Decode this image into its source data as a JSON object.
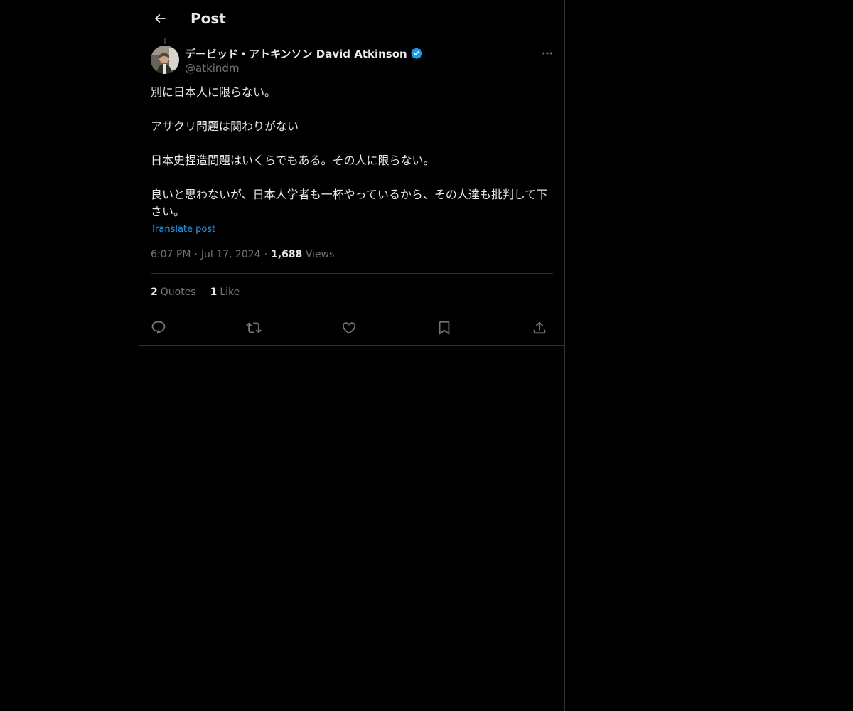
{
  "header": {
    "title": "Post",
    "back_icon": "arrow-left-icon"
  },
  "author": {
    "display_name": "デービッド・アトキンソン David Atkinson",
    "handle": "@atkindm",
    "verified_color": "#1d9bf0"
  },
  "post": {
    "paragraphs": [
      "別に日本人に限らない。",
      "アサクリ問題は関わりがない",
      "日本史捏造問題はいくらでもある。その人に限らない。",
      "良いと思わないが、日本人学者も一杯やっているから、その人達も批判して下さい。"
    ],
    "translate_label": "Translate post",
    "time": "6:07 PM",
    "date": "Jul 17, 2024",
    "separator": "·",
    "views_count": "1,688",
    "views_label": "Views"
  },
  "stats": {
    "quotes_count": "2",
    "quotes_label": "Quotes",
    "likes_count": "1",
    "likes_label": "Like"
  },
  "actions": [
    {
      "name": "reply",
      "icon": "reply-icon"
    },
    {
      "name": "repost",
      "icon": "repost-icon"
    },
    {
      "name": "like",
      "icon": "heart-icon"
    },
    {
      "name": "bookmark",
      "icon": "bookmark-icon"
    },
    {
      "name": "share",
      "icon": "share-icon"
    }
  ],
  "colors": {
    "background": "#000000",
    "text": "#e7e9ea",
    "muted": "#71767b",
    "accent": "#1d9bf0",
    "border": "#2f3336"
  }
}
